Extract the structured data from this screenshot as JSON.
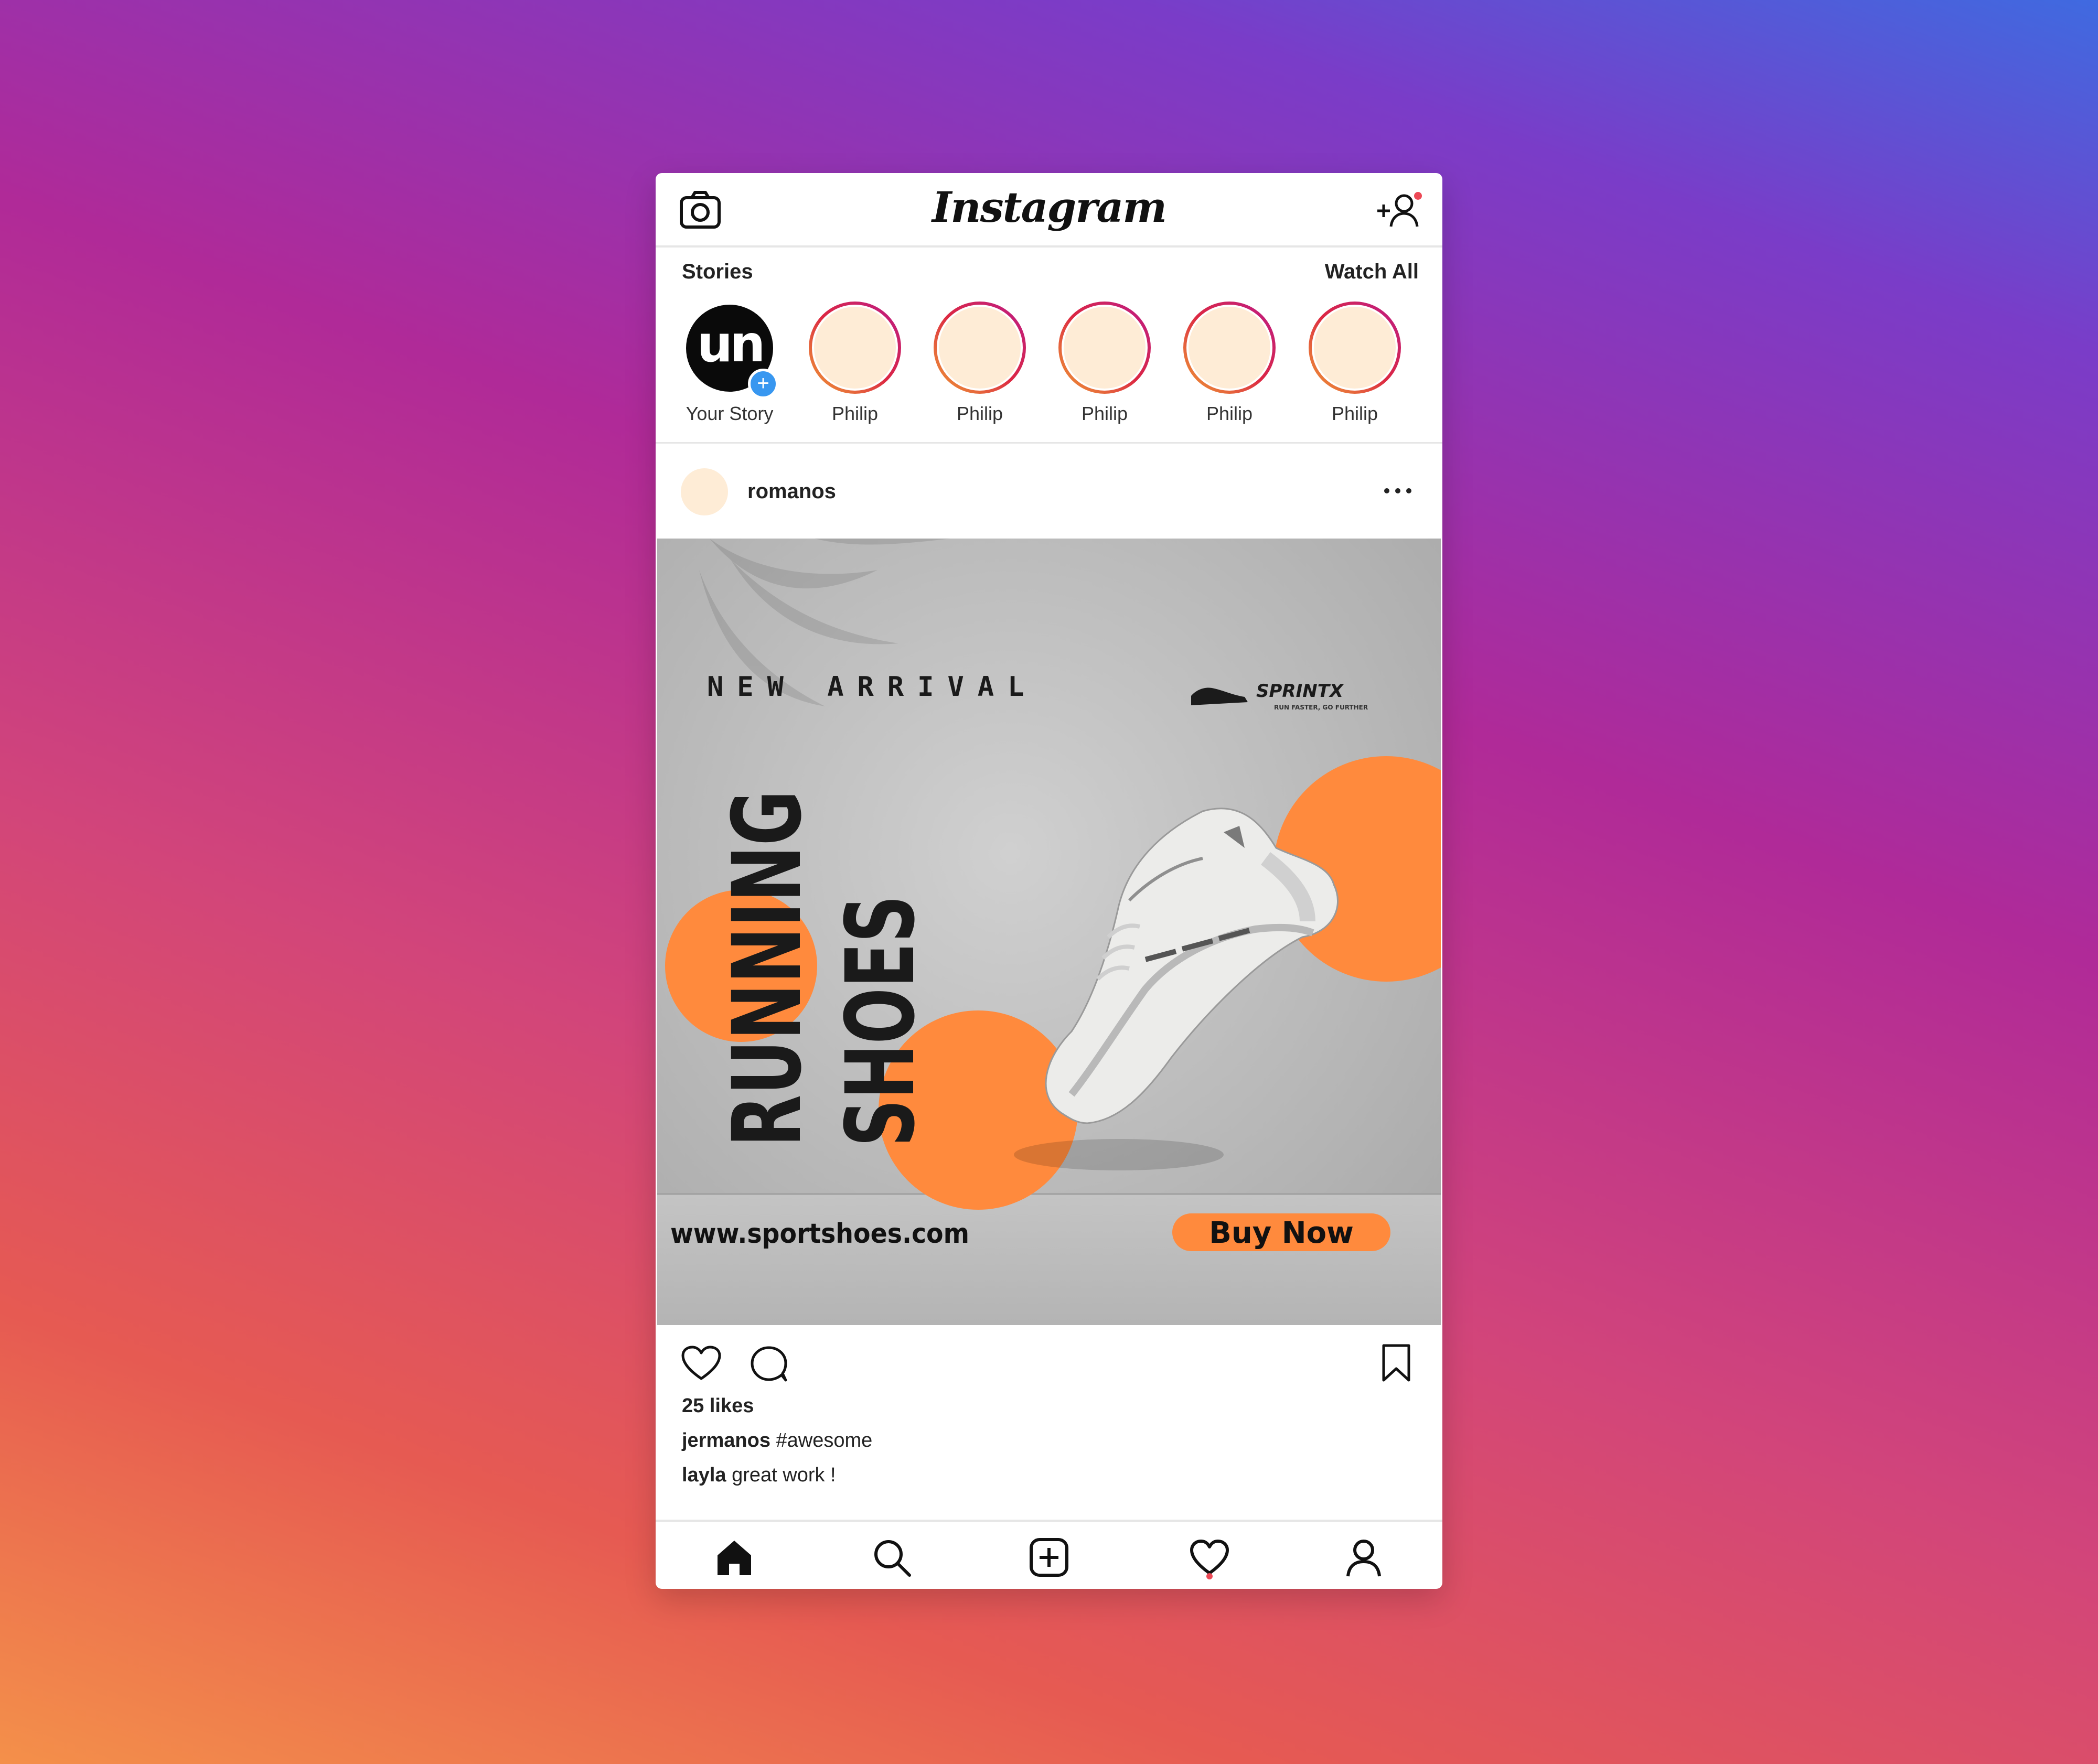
{
  "header": {
    "brand": "Instagram"
  },
  "stories": {
    "title": "Stories",
    "watch_all": "Watch All",
    "own": {
      "avatar_text": "un",
      "label": "Your Story"
    },
    "items": [
      {
        "label": "Philip"
      },
      {
        "label": "Philip"
      },
      {
        "label": "Philip"
      },
      {
        "label": "Philip"
      },
      {
        "label": "Philip"
      }
    ]
  },
  "post": {
    "username": "romanos",
    "creative": {
      "headline_top": "NEW ARRIVAL",
      "brand_logo_text": "SPRINTX",
      "brand_tagline": "RUN FASTER, GO FURTHER",
      "title_line1": "RUNNING",
      "title_line2": "SHOES",
      "website": "www.sportshoes.com",
      "cta": "Buy Now",
      "accent_color": "#ff8a3d"
    },
    "likes": "25 likes",
    "comments": [
      {
        "user": "jermanos",
        "text": " #awesome"
      },
      {
        "user": "layla",
        "text": " great work !"
      }
    ]
  },
  "icons": {
    "camera": "camera-icon",
    "add_user": "add-user-icon",
    "more": "more-options-icon",
    "like": "heart-icon",
    "comment": "comment-icon",
    "save": "bookmark-icon",
    "nav": [
      "home-icon",
      "search-icon",
      "add-post-icon",
      "activity-heart-icon",
      "profile-icon"
    ]
  }
}
